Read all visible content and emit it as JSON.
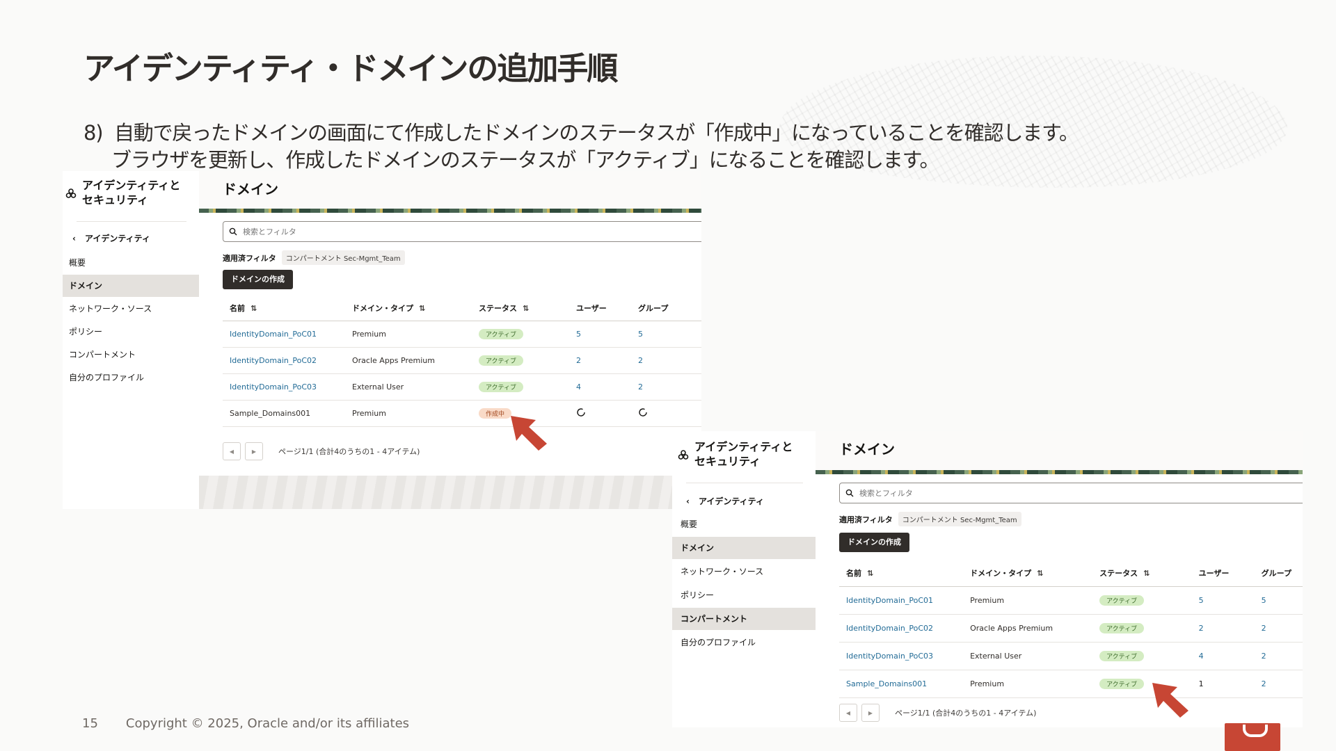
{
  "slide": {
    "title": "アイデンティティ・ドメインの追加手順",
    "step_number": "8)",
    "step_line1": "自動で戻ったドメインの画面にて作成したドメインのステータスが「作成中」になっていることを確認します。",
    "step_line2": "ブラウザを更新し、作成したドメインのステータスが「アクティブ」になることを確認します。",
    "page_number": "15",
    "copyright": "Copyright © 2025, Oracle and/or its affiliates"
  },
  "console": {
    "nav_title_line1": "アイデンティティと",
    "nav_title_line2": "セキュリティ",
    "nav_back": "アイデンティティ",
    "nav_items": [
      "概要",
      "ドメイン",
      "ネットワーク・ソース",
      "ポリシー",
      "コンパートメント",
      "自分のプロファイル"
    ],
    "page_title": "ドメイン",
    "search_placeholder": "検索とフィルタ",
    "applied_filters_label": "適用済フィルタ",
    "filter_chip": "コンパートメント Sec-Mgmt_Team",
    "create_button": "ドメインの作成",
    "columns": [
      "名前",
      "ドメイン・タイプ",
      "ステータス",
      "ユーザー",
      "グループ"
    ],
    "pager_text": "ページ1/1 (合計4のうちの1 - 4アイテム)",
    "prev_icon": "chevron-left-icon",
    "next_icon": "chevron-right-icon"
  },
  "shot1": {
    "rows": [
      {
        "name": "IdentityDomain_PoC01",
        "type": "Premium",
        "status": "アクティブ",
        "users": "5",
        "groups": "5"
      },
      {
        "name": "IdentityDomain_PoC02",
        "type": "Oracle Apps Premium",
        "status": "アクティブ",
        "users": "2",
        "groups": "2"
      },
      {
        "name": "IdentityDomain_PoC03",
        "type": "External User",
        "status": "アクティブ",
        "users": "4",
        "groups": "2"
      },
      {
        "name": "Sample_Domains001",
        "type": "Premium",
        "status": "作成中",
        "users": "",
        "groups": ""
      }
    ]
  },
  "shot2": {
    "rows": [
      {
        "name": "IdentityDomain_PoC01",
        "type": "Premium",
        "status": "アクティブ",
        "users": "5",
        "groups": "5"
      },
      {
        "name": "IdentityDomain_PoC02",
        "type": "Oracle Apps Premium",
        "status": "アクティブ",
        "users": "2",
        "groups": "2"
      },
      {
        "name": "IdentityDomain_PoC03",
        "type": "External User",
        "status": "アクティブ",
        "users": "4",
        "groups": "2"
      },
      {
        "name": "Sample_Domains001",
        "type": "Premium",
        "status": "アクティブ",
        "users": "1",
        "groups": "2"
      }
    ]
  },
  "colors": {
    "accent_red": "#c74634",
    "link_blue": "#226b96",
    "badge_active_bg": "#d4ecc2",
    "badge_creating_bg": "#f9dac7",
    "button_dark": "#312d2a"
  }
}
